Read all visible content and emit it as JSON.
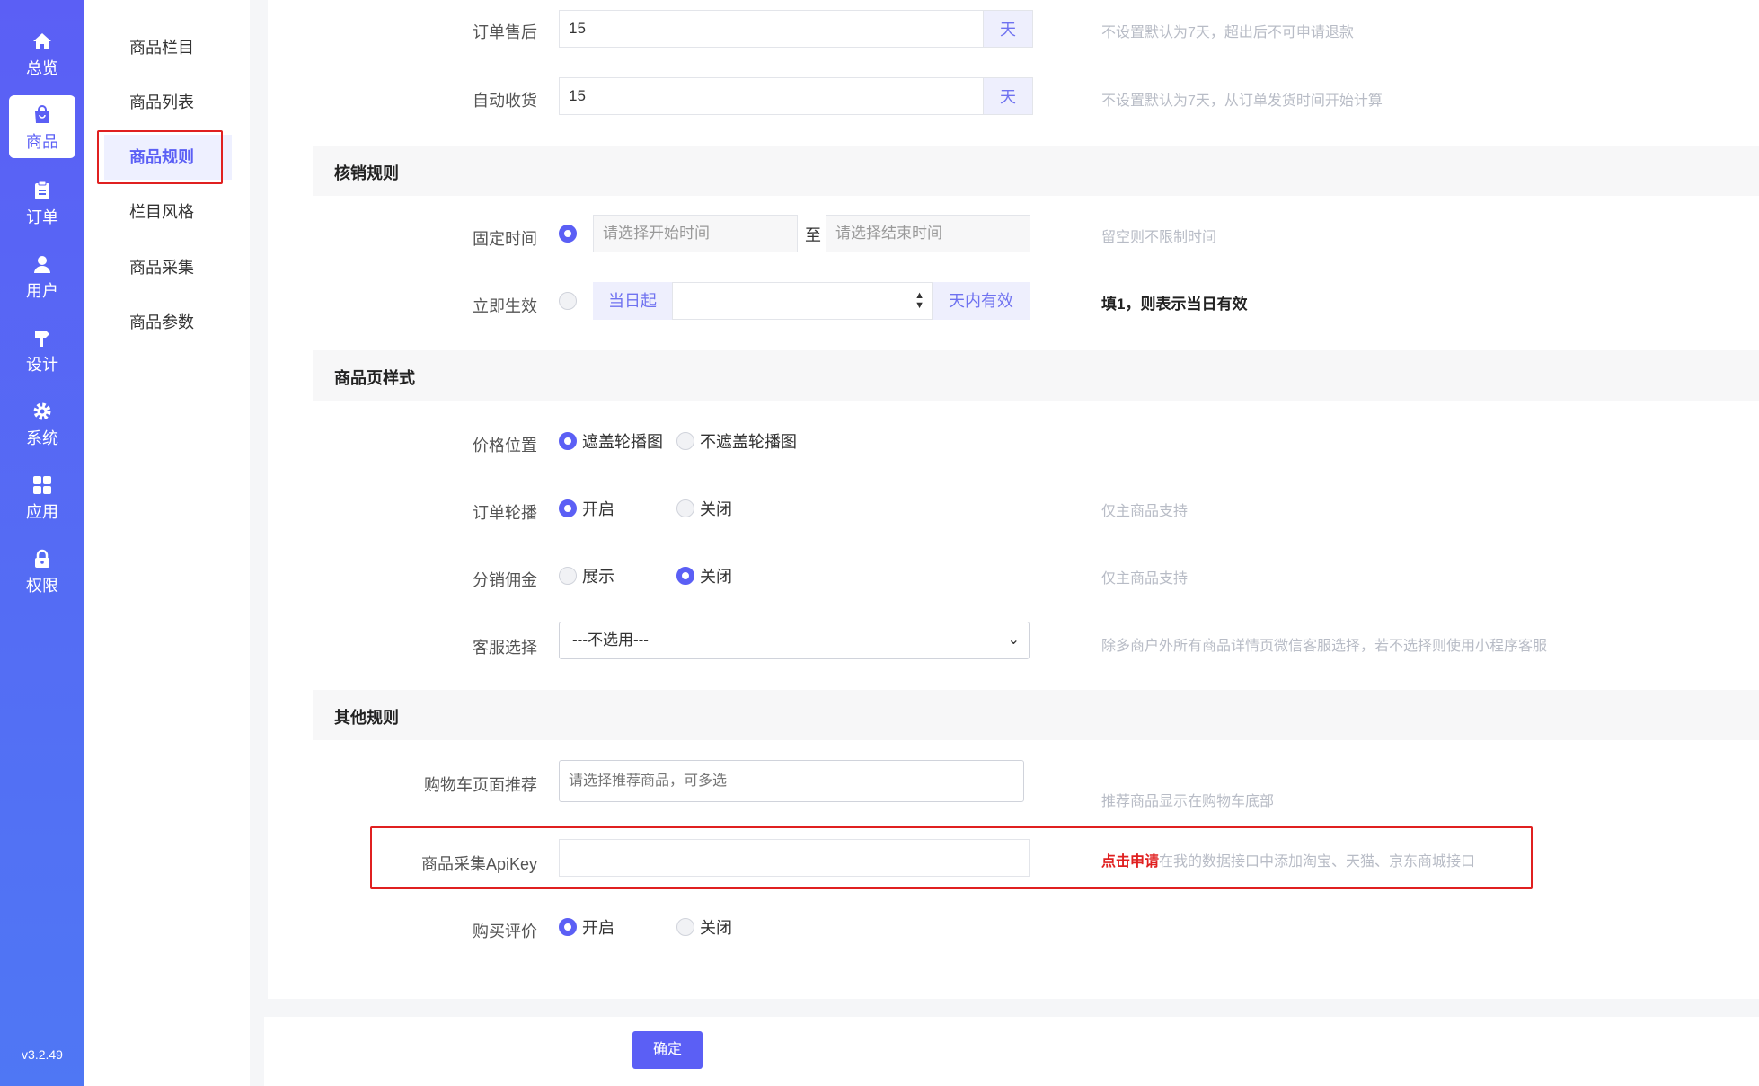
{
  "nav": {
    "items": [
      {
        "label": "总览",
        "icon": "home-icon"
      },
      {
        "label": "商品",
        "icon": "bag-icon"
      },
      {
        "label": "订单",
        "icon": "clipboard-icon"
      },
      {
        "label": "用户",
        "icon": "user-icon"
      },
      {
        "label": "设计",
        "icon": "brush-icon"
      },
      {
        "label": "系统",
        "icon": "gear-icon"
      },
      {
        "label": "应用",
        "icon": "grid-icon"
      },
      {
        "label": "权限",
        "icon": "lock-icon"
      }
    ],
    "active": "商品",
    "version": "v3.2.49"
  },
  "subnav": {
    "items": [
      "商品栏目",
      "商品列表",
      "商品规则",
      "栏目风格",
      "商品采集",
      "商品参数"
    ],
    "active": "商品规则"
  },
  "form": {
    "after_sale": {
      "label": "订单售后",
      "value": "15",
      "unit": "天",
      "hint": "不设置默认为7天，超出后不可申请退款"
    },
    "auto_receive": {
      "label": "自动收货",
      "value": "15",
      "unit": "天",
      "hint": "不设置默认为7天，从订单发货时间开始计算"
    },
    "verify_section": "核销规则",
    "fixed_time": {
      "label": "固定时间",
      "start_placeholder": "请选择开始时间",
      "to": "至",
      "end_placeholder": "请选择结束时间",
      "hint": "留空则不限制时间"
    },
    "immediate": {
      "label": "立即生效",
      "prefix": "当日起",
      "suffix": "天内有效",
      "hint": "填1，则表示当日有效"
    },
    "page_section": "商品页样式",
    "price_position": {
      "label": "价格位置",
      "option_on": "遮盖轮播图",
      "option_off": "不遮盖轮播图"
    },
    "order_carousel": {
      "label": "订单轮播",
      "option_on": "开启",
      "option_off": "关闭",
      "hint": "仅主商品支持"
    },
    "commission": {
      "label": "分销佣金",
      "option_on": "展示",
      "option_off": "关闭",
      "hint": "仅主商品支持"
    },
    "customer_service": {
      "label": "客服选择",
      "value": "---不选用---",
      "hint": "除多商户外所有商品详情页微信客服选择，若不选择则使用小程序客服"
    },
    "other_section": "其他规则",
    "cart_recommend": {
      "label": "购物车页面推荐",
      "placeholder": "请选择推荐商品，可多选",
      "hint": "推荐商品显示在购物车底部"
    },
    "apikey": {
      "label": "商品采集ApiKey",
      "value": "",
      "link": "点击申请",
      "hint": "在我的数据接口中添加淘宝、天猫、京东商城接口"
    },
    "review": {
      "label": "购买评价",
      "option_on": "开启",
      "option_off": "关闭"
    }
  },
  "footer": {
    "confirm": "确定"
  },
  "colors": {
    "primary": "#5b5ff5",
    "highlight": "#e02020",
    "hint": "#b8bcc6"
  }
}
